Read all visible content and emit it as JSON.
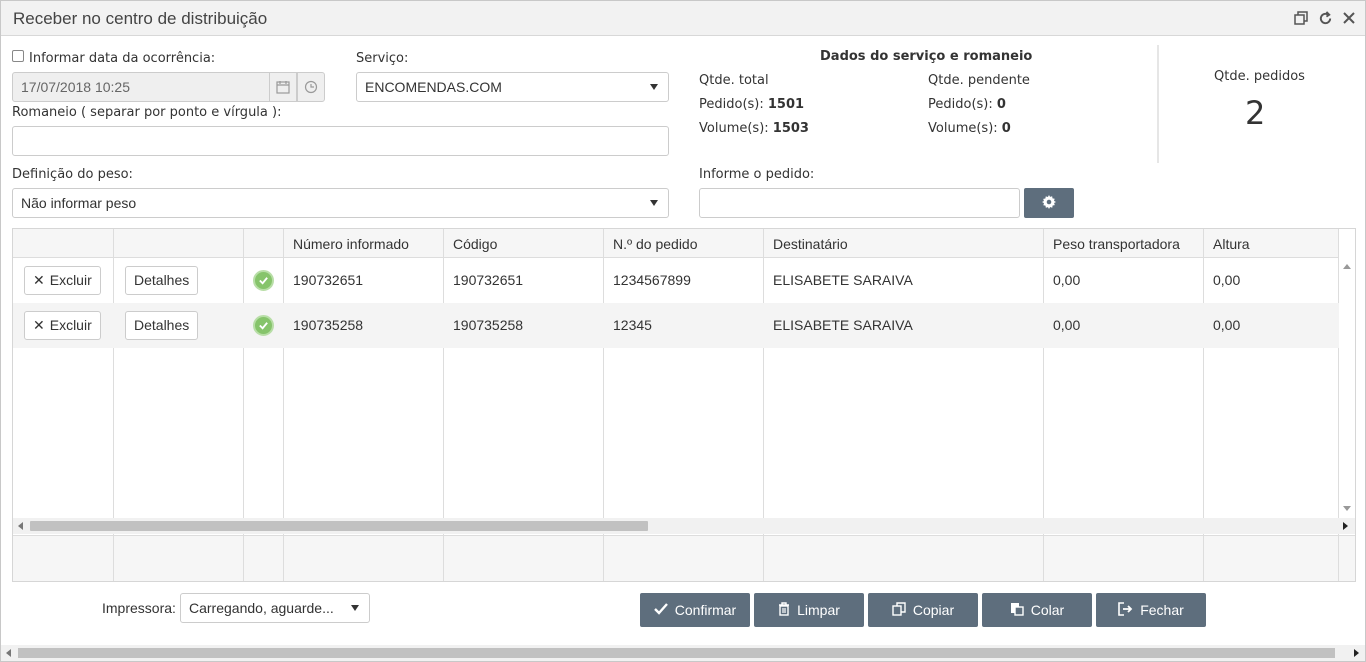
{
  "window": {
    "title": "Receber no centro de distribuição"
  },
  "form": {
    "occurrence_label": "Informar data da ocorrência:",
    "occurrence_value": "17/07/2018 10:25",
    "service_label": "Serviço:",
    "service_value": "ENCOMENDAS.COM",
    "romaneio_label": "Romaneio ( separar por ponto e vírgula ):",
    "romaneio_value": "",
    "weight_label": "Definição do peso:",
    "weight_value": "Não informar peso",
    "order_label": "Informe o pedido:",
    "order_value": ""
  },
  "summary": {
    "title": "Dados do serviço e romaneio",
    "total_label": "Qtde. total",
    "pending_label": "Qtde. pendente",
    "orders_label": "Pedido(s):",
    "volumes_label": "Volume(s):",
    "total_orders": "1501",
    "total_volumes": "1503",
    "pending_orders": "0",
    "pending_volumes": "0",
    "qty_orders_label": "Qtde. pedidos",
    "qty_orders_value": "2"
  },
  "grid": {
    "columns": [
      "Número informado",
      "Código",
      "N.º do pedido",
      "Destinatário",
      "Peso transportadora",
      "Altura"
    ],
    "delete_label": "Excluir",
    "details_label": "Detalhes",
    "rows": [
      {
        "numero": "190732651",
        "codigo": "190732651",
        "pedido": "1234567899",
        "destinatario": "ELISABETE SARAIVA",
        "peso": "0,00",
        "altura": "0,00"
      },
      {
        "numero": "190735258",
        "codigo": "190735258",
        "pedido": "12345",
        "destinatario": "ELISABETE SARAIVA",
        "peso": "0,00",
        "altura": "0,00"
      }
    ]
  },
  "footer": {
    "printer_label": "Impressora:",
    "printer_value": "Carregando, aguarde...",
    "confirm": "Confirmar",
    "clear": "Limpar",
    "copy": "Copiar",
    "paste": "Colar",
    "close": "Fechar"
  }
}
